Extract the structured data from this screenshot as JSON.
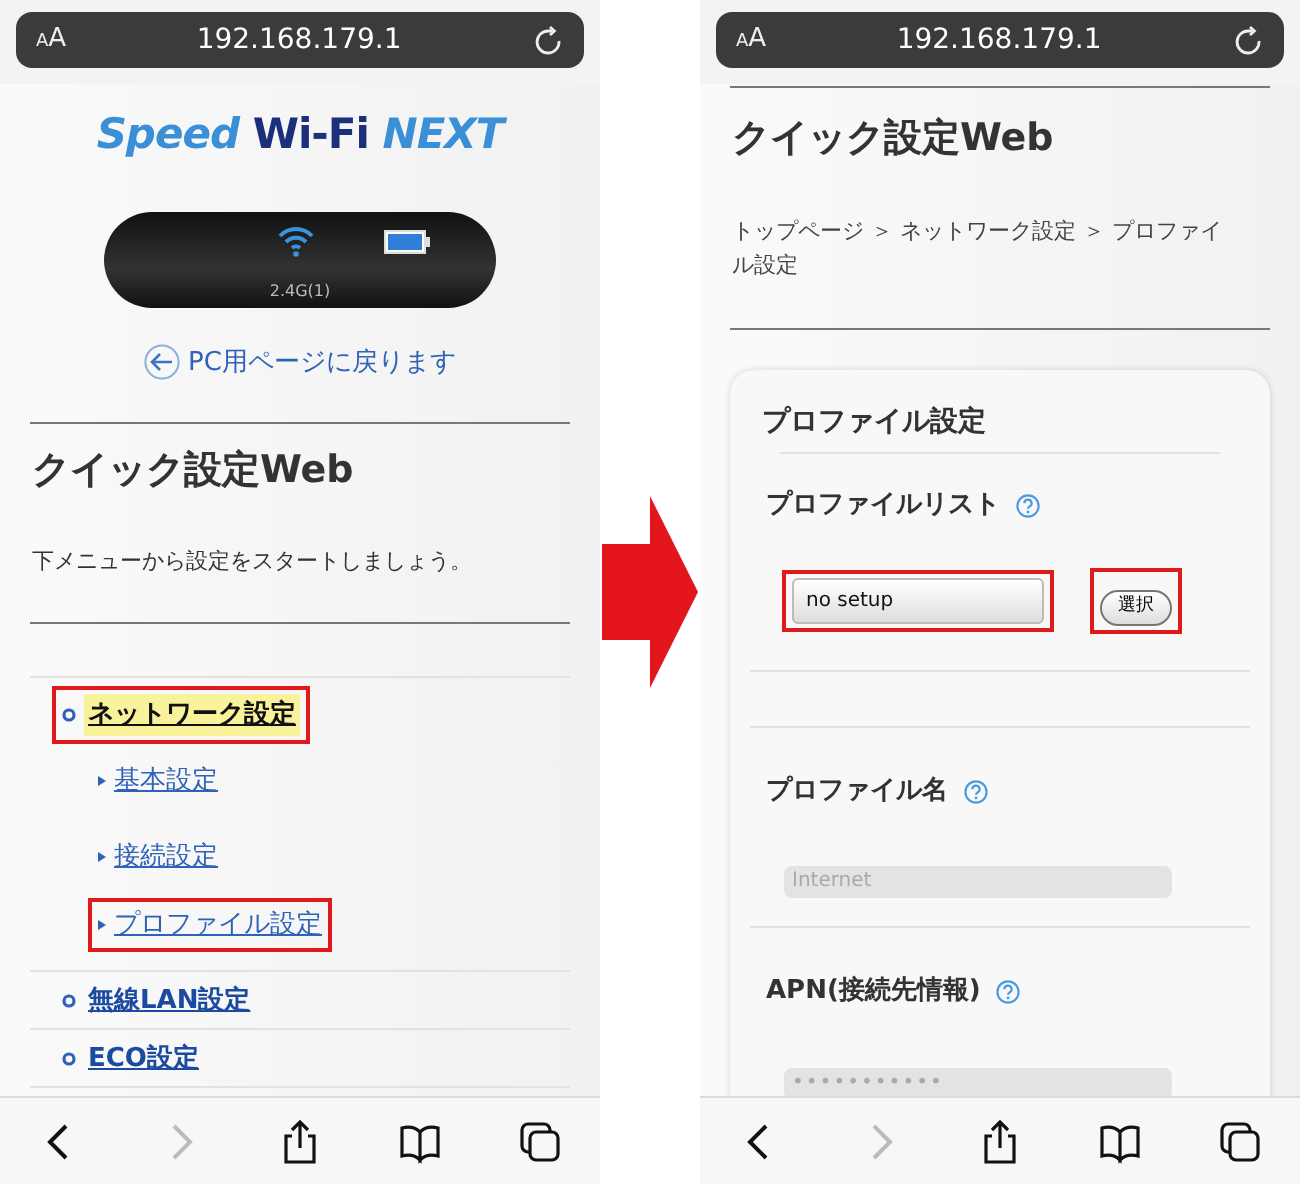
{
  "left_screen": {
    "address_bar": {
      "text_size": "AA",
      "url": "192.168.179.1"
    },
    "logo": [
      {
        "text": "Speed",
        "kind": "light"
      },
      {
        "text": "Wi-Fi",
        "kind": "dark"
      },
      {
        "text": "NEXT",
        "kind": "light"
      }
    ],
    "device": {
      "band": "2.4G(1)"
    },
    "back_link": "PC用ページに戻ります",
    "title": "クイック設定Web",
    "intro": "下メニューから設定をスタートしましょう。",
    "menu": [
      {
        "label": "ネットワーク設定",
        "current": true,
        "annotated": true,
        "children": [
          {
            "label": "基本設定",
            "annotated": false
          },
          {
            "label": "接続設定",
            "annotated": false
          },
          {
            "label": "プロファイル設定",
            "annotated": true
          }
        ]
      },
      {
        "label": "無線LAN設定",
        "current": false,
        "annotated": false
      },
      {
        "label": "ECO設定",
        "current": false,
        "annotated": false
      }
    ],
    "toolbar": {
      "back_enabled": true,
      "forward_enabled": false
    }
  },
  "right_screen": {
    "address_bar": {
      "text_size": "AA",
      "url": "192.168.179.1"
    },
    "title": "クイック設定Web",
    "breadcrumb": "トップページ ＞ ネットワーク設定 ＞ プロファイル設定",
    "card": {
      "title": "プロファイル設定",
      "fields": [
        {
          "kind": "select",
          "label": "プロファイルリスト",
          "value": "no setup",
          "button": "選択",
          "annotated": true
        },
        {
          "kind": "text",
          "label": "プロファイル名",
          "value": "Internet",
          "disabled": true
        },
        {
          "kind": "password",
          "label": "APN(接続先情報)",
          "value": "•••••••••••",
          "disabled": true
        }
      ]
    },
    "toolbar": {
      "back_enabled": true,
      "forward_enabled": false
    }
  }
}
